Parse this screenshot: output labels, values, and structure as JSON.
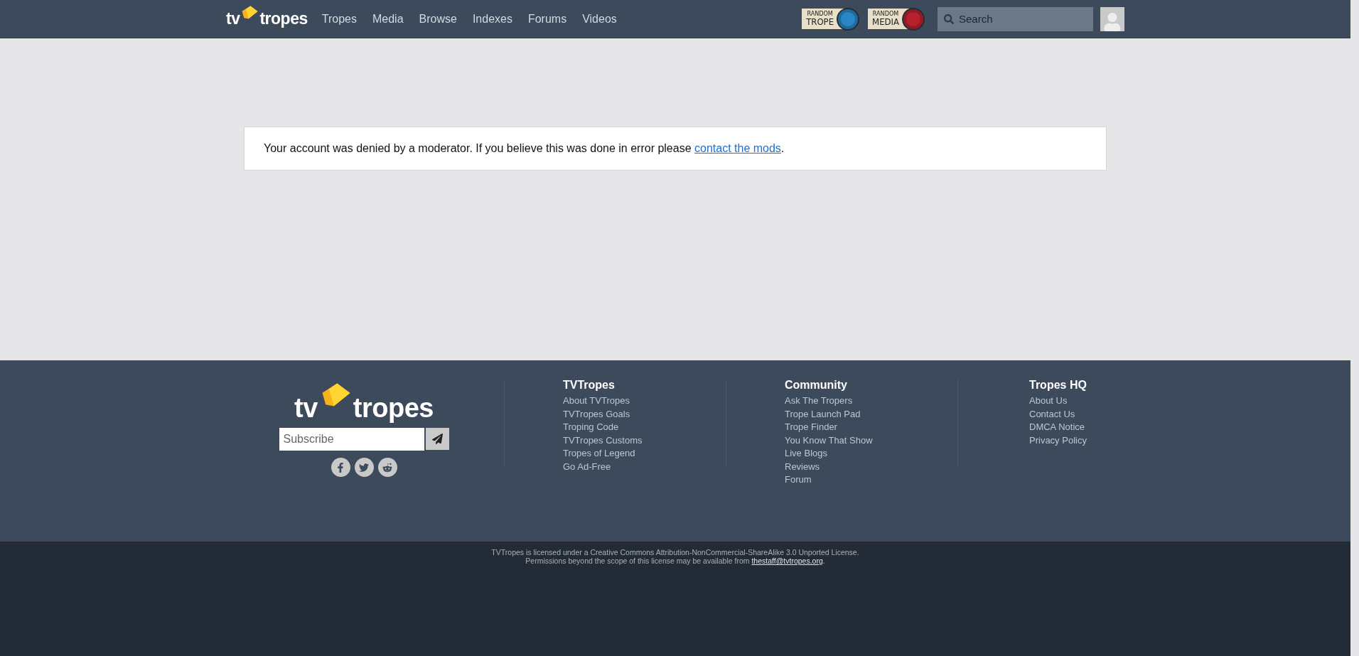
{
  "header": {
    "logo": [
      "tv",
      "tropes"
    ],
    "nav": [
      "Tropes",
      "Media",
      "Browse",
      "Indexes",
      "Forums",
      "Videos"
    ],
    "random_buttons": [
      {
        "line1": "RANDOM",
        "line2": "TROPE",
        "color": "#2a86c4"
      },
      {
        "line1": "RANDOM",
        "line2": "MEDIA",
        "color": "#b8202e"
      }
    ],
    "search": {
      "placeholder": "Search"
    }
  },
  "message": {
    "text": "Your account was denied by a moderator. If you believe this was done in error please ",
    "link": "contact the mods",
    "end": "."
  },
  "footer": {
    "logo": [
      "tv",
      "tropes"
    ],
    "subscribe": {
      "placeholder": "Subscribe"
    },
    "columns": [
      {
        "title": "TVTropes",
        "links": [
          "About TVTropes",
          "TVTropes Goals",
          "Troping Code",
          "TVTropes Customs",
          "Tropes of Legend",
          "Go Ad-Free"
        ]
      },
      {
        "title": "Community",
        "links": [
          "Ask The Tropers",
          "Trope Launch Pad",
          "Trope Finder",
          "You Know That Show",
          "Live Blogs",
          "Reviews",
          "Forum"
        ]
      },
      {
        "title": "Tropes HQ",
        "links": [
          "About Us",
          "Contact Us",
          "DMCA Notice",
          "Privacy Policy"
        ]
      }
    ]
  },
  "license": {
    "line1": "TVTropes is licensed under a Creative Commons Attribution-NonCommercial-ShareAlike 3.0 Unported License.",
    "line2": "Permissions beyond the scope of this license may be available from ",
    "email": "thestaff@tvtropes.org",
    "end": "."
  }
}
